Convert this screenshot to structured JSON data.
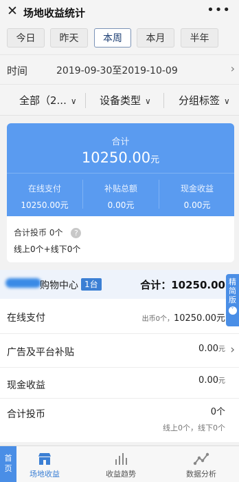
{
  "header": {
    "close_icon": "close-icon",
    "title": "场地收益统计",
    "more_icon": "more-icon"
  },
  "periods": [
    "今日",
    "昨天",
    "本周",
    "本月",
    "半年"
  ],
  "active_period": "本周",
  "date": {
    "label": "时间",
    "range": "2019-09-30至2019-10-09"
  },
  "filters": {
    "all": "全部（2...",
    "device_type": "设备类型",
    "group_tag": "分组标签"
  },
  "summary": {
    "total_label": "合计",
    "total_value": "10250.00",
    "unit": "元",
    "online_label": "在线支付",
    "online_value": "10250.00元",
    "subsidy_label": "补贴总额",
    "subsidy_value": "0.00元",
    "cash_label": "现金收益",
    "cash_value": "0.00元",
    "coins_label": "合计投币 0个",
    "coins_split": "线上0个+线下0个"
  },
  "venue": {
    "name_suffix": "购物中心",
    "badge": "1台",
    "total": "合计：10250.00",
    "rows": {
      "online": {
        "label": "在线支付",
        "note": "出币0个，",
        "value": "10250.00元"
      },
      "ad": {
        "label": "广告及平台补贴",
        "value": "0.00",
        "unit": "元"
      },
      "cash": {
        "label": "现金收益",
        "value": "0.00",
        "unit": "元"
      },
      "coins": {
        "label": "合计投币",
        "value": "0个",
        "note": "线上0个，线下0个"
      }
    }
  },
  "side_tab": {
    "label": "精简版",
    "icon": "chevron-down-icon"
  },
  "bottom_nav": {
    "home": "首页",
    "tabs": [
      {
        "label": "场地收益",
        "icon": "store-icon"
      },
      {
        "label": "收益趋势",
        "icon": "bar-chart-icon"
      },
      {
        "label": "数据分析",
        "icon": "line-chart-icon"
      }
    ]
  },
  "colors": {
    "accent": "#5a9bf0",
    "active_border": "#7a92b6"
  }
}
